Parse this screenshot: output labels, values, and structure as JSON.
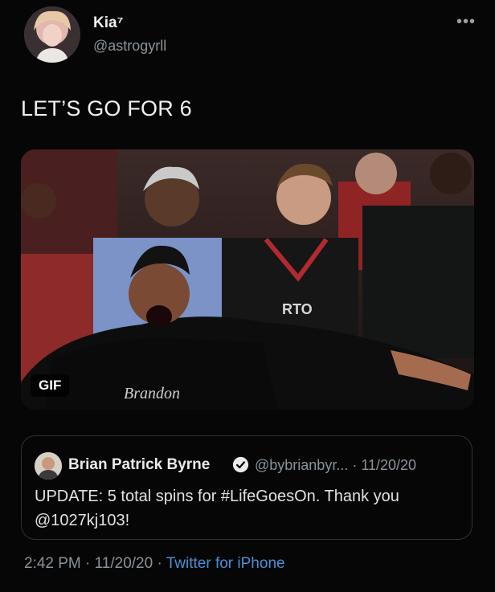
{
  "tweet": {
    "author_name": "Kia⁷",
    "author_handle": "@astrogyrll",
    "more_icon": "more-horizontal-icon",
    "text": "LET’S GO FOR 6",
    "media": {
      "type": "gif",
      "badge": "GIF",
      "shirt_text": "Brandon",
      "jersey_text": "RTO"
    },
    "quoted": {
      "author_name": "Brian Patrick Byrne",
      "verified": true,
      "handle_and_date": "@bybrianbyr... · 11/20/20",
      "text": "UPDATE: 5 total spins for #LifeGoesOn. Thank you @1027kj103!"
    },
    "footer": {
      "time_date": "2:42 PM · 11/20/20 · ",
      "source": "Twitter for iPhone"
    }
  },
  "colors": {
    "background": "#060606",
    "muted_text": "#8b9299",
    "link": "#4a8fd6",
    "verified": "#1d9bf0"
  }
}
